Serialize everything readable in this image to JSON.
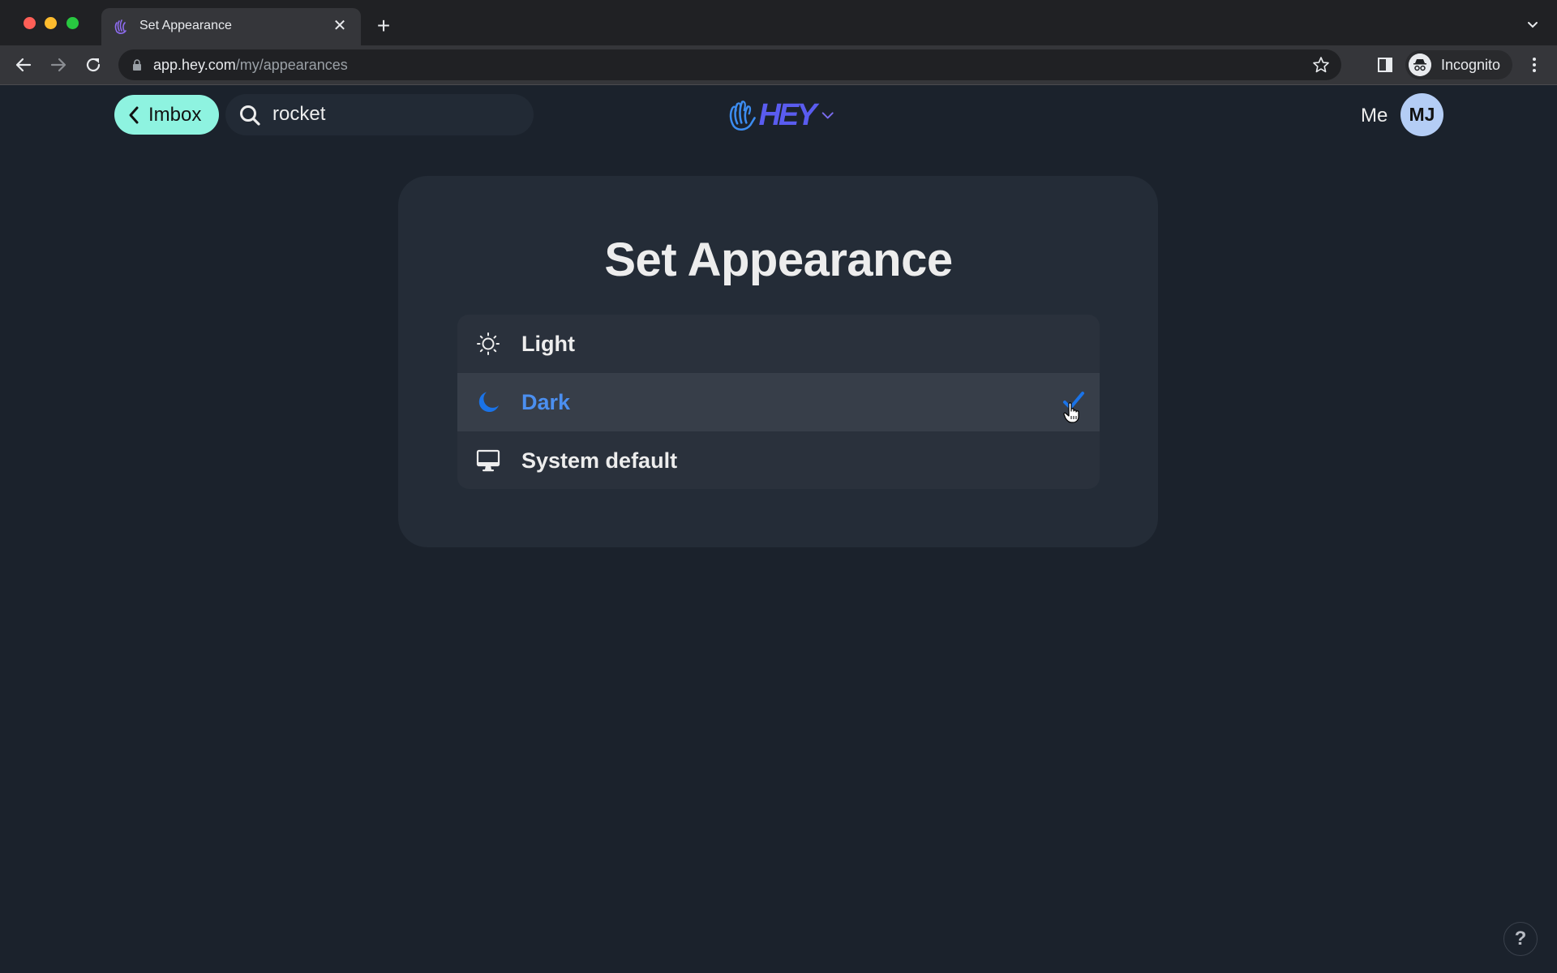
{
  "browser": {
    "tab": {
      "title": "Set Appearance",
      "favicon": "hey-hand-icon"
    },
    "new_tab_label": "+",
    "address_bar": {
      "host": "app.hey.com",
      "path": "/my/appearances"
    },
    "profile_label": "Incognito"
  },
  "header": {
    "back_button_label": "Imbox",
    "search": {
      "value": "rocket",
      "placeholder": ""
    },
    "logo_text": "HEY",
    "me_label": "Me",
    "avatar_initials": "MJ"
  },
  "page": {
    "title": "Set Appearance",
    "options": [
      {
        "label": "Light",
        "icon": "sun-icon",
        "selected": false
      },
      {
        "label": "Dark",
        "icon": "moon-icon",
        "selected": true
      },
      {
        "label": "System default",
        "icon": "monitor-icon",
        "selected": false
      }
    ]
  },
  "help_label": "?",
  "colors": {
    "background": "#1b222c",
    "card": "#242c37",
    "accent_blue": "#1a73e8",
    "selected_text": "#4b8ff0",
    "imbox_button": "#8ef3e0",
    "avatar": "#b4cdf5",
    "logo": "#5a5cf0"
  }
}
